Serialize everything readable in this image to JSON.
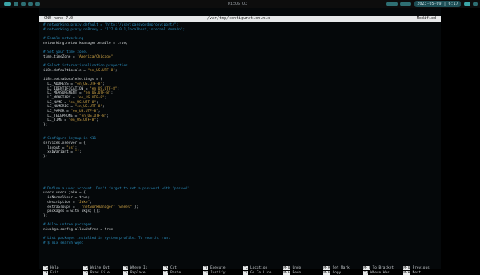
{
  "system_bar": {
    "title": "NixOS OZ",
    "clock": "2023-05-09 | 6:17 PM",
    "colors": {
      "accent": "#3ba6a8",
      "dim": "#2e6f73"
    }
  },
  "nano": {
    "version": "GNU nano 7.0",
    "file_path": "/var/tmp/configuration.nix",
    "state": "Modified"
  },
  "editor_lines": [
    {
      "text": "# networking.proxy.default = \"http://user:password@proxy:port/\";",
      "style": "cmt"
    },
    {
      "text": "# networking.proxy.noProxy = \"127.0.0.1,localhost,internal.domain\";",
      "style": "cmt"
    },
    {
      "text": "",
      "style": "code"
    },
    {
      "text": "# Enable networking",
      "style": "cmt"
    },
    {
      "text": "networking.networkmanager.enable = true;",
      "style": "code"
    },
    {
      "text": "",
      "style": "code"
    },
    {
      "text": "# Set your time zone.",
      "style": "cmt"
    },
    {
      "text": "time.timeZone = \"America/Chicago\";",
      "style": "code"
    },
    {
      "text": "",
      "style": "code"
    },
    {
      "text": "# Select internationalisation properties.",
      "style": "cmt"
    },
    {
      "text": "i18n.defaultLocale = \"en_US.UTF-8\";",
      "style": "code"
    },
    {
      "text": "",
      "style": "code"
    },
    {
      "text": "i18n.extraLocaleSettings = {",
      "style": "code"
    },
    {
      "text": "  LC_ADDRESS = \"en_US.UTF-8\";",
      "style": "code"
    },
    {
      "text": "  LC_IDENTIFICATION = \"en_US.UTF-8\";",
      "style": "code"
    },
    {
      "text": "  LC_MEASUREMENT = \"en_US.UTF-8\";",
      "style": "code"
    },
    {
      "text": "  LC_MONETARY = \"en_US.UTF-8\";",
      "style": "code"
    },
    {
      "text": "  LC_NAME = \"en_US.UTF-8\";",
      "style": "code"
    },
    {
      "text": "  LC_NUMERIC = \"en_US.UTF-8\";",
      "style": "code"
    },
    {
      "text": "  LC_PAPER = \"en_US.UTF-8\";",
      "style": "code"
    },
    {
      "text": "  LC_TELEPHONE = \"en_US.UTF-8\";",
      "style": "code"
    },
    {
      "text": "  LC_TIME = \"en_US.UTF-8\";",
      "style": "code"
    },
    {
      "text": "};",
      "style": "code"
    },
    {
      "text": "",
      "style": "code"
    },
    {
      "text": "",
      "style": "code"
    },
    {
      "text": "# Configure keymap in X11",
      "style": "cmt"
    },
    {
      "text": "services.xserver = {",
      "style": "code"
    },
    {
      "text": "  layout = \"us\";",
      "style": "code"
    },
    {
      "text": "  xkbVariant = \"\";",
      "style": "code"
    },
    {
      "text": "};",
      "style": "code"
    },
    {
      "text": "",
      "style": "code"
    },
    {
      "text": "",
      "style": "code"
    },
    {
      "text": "",
      "style": "code"
    },
    {
      "text": "",
      "style": "code"
    },
    {
      "text": "",
      "style": "code"
    },
    {
      "text": "",
      "style": "code"
    },
    {
      "text": "# Define a user account. Don't forget to set a password with 'passwd'.",
      "style": "cmt"
    },
    {
      "text": "users.users.jake = {",
      "style": "code"
    },
    {
      "text": "  isNormalUser = true;",
      "style": "code"
    },
    {
      "text": "  description = \"Jake\";",
      "style": "code"
    },
    {
      "text": "  extraGroups = [ \"networkmanager\" \"wheel\" ];",
      "style": "code"
    },
    {
      "text": "  packages = with pkgs; [];",
      "style": "code"
    },
    {
      "text": "};",
      "style": "code"
    },
    {
      "text": "",
      "style": "code"
    },
    {
      "text": "# Allow unfree packages",
      "style": "cmt"
    },
    {
      "text": "nixpkgs.config.allowUnfree = true;",
      "style": "code"
    },
    {
      "text": "",
      "style": "code"
    },
    {
      "text": "# List packages installed in system profile. To search, run:",
      "style": "cmt"
    },
    {
      "text": "# $ nix search wget",
      "style": "cmt"
    }
  ],
  "shortcuts": [
    [
      {
        "key": "^G",
        "label": "Help"
      },
      {
        "key": "^O",
        "label": "Write Out"
      },
      {
        "key": "^W",
        "label": "Where Is"
      },
      {
        "key": "^K",
        "label": "Cut"
      },
      {
        "key": "^T",
        "label": "Execute"
      },
      {
        "key": "^C",
        "label": "Location"
      },
      {
        "key": "M-U",
        "label": "Undo"
      },
      {
        "key": "M-A",
        "label": "Set Mark"
      },
      {
        "key": "M-]",
        "label": "To Bracket"
      },
      {
        "key": "M-Q",
        "label": "Previous"
      }
    ],
    [
      {
        "key": "^X",
        "label": "Exit"
      },
      {
        "key": "^R",
        "label": "Read File"
      },
      {
        "key": "^\\",
        "label": "Replace"
      },
      {
        "key": "^U",
        "label": "Paste"
      },
      {
        "key": "^J",
        "label": "Justify"
      },
      {
        "key": "^/",
        "label": "Go To Line"
      },
      {
        "key": "M-E",
        "label": "Redo"
      },
      {
        "key": "M-6",
        "label": "Copy"
      },
      {
        "key": "^Q",
        "label": "Where Was"
      },
      {
        "key": "M-W",
        "label": "Next"
      }
    ]
  ]
}
